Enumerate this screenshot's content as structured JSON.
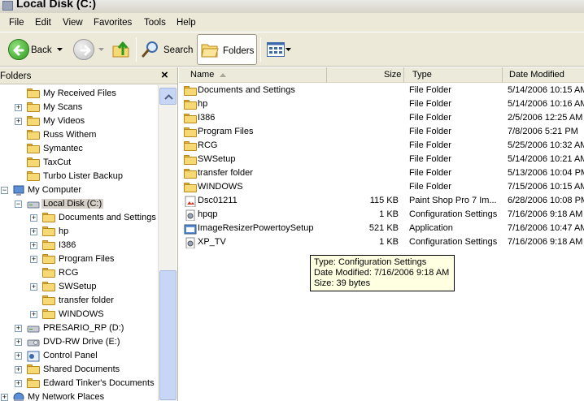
{
  "window": {
    "title": "Local Disk (C:)"
  },
  "menu": [
    "File",
    "Edit",
    "View",
    "Favorites",
    "Tools",
    "Help"
  ],
  "toolbar": {
    "back": "Back",
    "search": "Search",
    "folders": "Folders"
  },
  "folders_pane": {
    "title": "Folders",
    "close": "×",
    "items": [
      {
        "label": "My Received Files",
        "exp": ""
      },
      {
        "label": "My Scans",
        "exp": "+"
      },
      {
        "label": "My Videos",
        "exp": "+"
      },
      {
        "label": "Russ Withem",
        "exp": ""
      },
      {
        "label": "Symantec",
        "exp": ""
      },
      {
        "label": "TaxCut",
        "exp": ""
      },
      {
        "label": "Turbo Lister Backup",
        "exp": ""
      },
      {
        "label": "My Computer",
        "exp": "−"
      },
      {
        "label": "Local Disk (C:)",
        "exp": "−"
      },
      {
        "label": "Documents and Settings",
        "exp": "+"
      },
      {
        "label": "hp",
        "exp": "+"
      },
      {
        "label": "I386",
        "exp": "+"
      },
      {
        "label": "Program Files",
        "exp": "+"
      },
      {
        "label": "RCG",
        "exp": ""
      },
      {
        "label": "SWSetup",
        "exp": "+"
      },
      {
        "label": "transfer folder",
        "exp": ""
      },
      {
        "label": "WINDOWS",
        "exp": "+"
      },
      {
        "label": "PRESARIO_RP (D:)",
        "exp": "+"
      },
      {
        "label": "DVD-RW Drive (E:)",
        "exp": "+"
      },
      {
        "label": "Control Panel",
        "exp": "+"
      },
      {
        "label": "Shared Documents",
        "exp": "+"
      },
      {
        "label": "Edward Tinker's Documents",
        "exp": "+"
      },
      {
        "label": "My Network Places",
        "exp": "+"
      }
    ]
  },
  "columns": {
    "name": "Name",
    "size": "Size",
    "type": "Type",
    "modified": "Date Modified"
  },
  "files": [
    {
      "name": "Documents and Settings",
      "size": "",
      "type": "File Folder",
      "modified": "5/14/2006 10:15 AM",
      "icon": "folder"
    },
    {
      "name": "hp",
      "size": "",
      "type": "File Folder",
      "modified": "5/14/2006 10:16 AM",
      "icon": "folder"
    },
    {
      "name": "I386",
      "size": "",
      "type": "File Folder",
      "modified": "2/5/2006 12:25 AM",
      "icon": "folder"
    },
    {
      "name": "Program Files",
      "size": "",
      "type": "File Folder",
      "modified": "7/8/2006 5:21 PM",
      "icon": "folder"
    },
    {
      "name": "RCG",
      "size": "",
      "type": "File Folder",
      "modified": "5/25/2006 10:32 AM",
      "icon": "folder"
    },
    {
      "name": "SWSetup",
      "size": "",
      "type": "File Folder",
      "modified": "5/14/2006 10:21 AM",
      "icon": "folder"
    },
    {
      "name": "transfer folder",
      "size": "",
      "type": "File Folder",
      "modified": "5/13/2006 10:04 PM",
      "icon": "folder"
    },
    {
      "name": "WINDOWS",
      "size": "",
      "type": "File Folder",
      "modified": "7/15/2006 10:15 AM",
      "icon": "folder"
    },
    {
      "name": "Dsc01211",
      "size": "115 KB",
      "type": "Paint Shop Pro 7 Im...",
      "modified": "6/28/2006 10:08 PM",
      "icon": "image"
    },
    {
      "name": "hpqp",
      "size": "1 KB",
      "type": "Configuration Settings",
      "modified": "7/16/2006 9:18 AM",
      "icon": "config"
    },
    {
      "name": "ImageResizerPowertoySetup",
      "size": "521 KB",
      "type": "Application",
      "modified": "7/16/2006 10:47 AM",
      "icon": "app"
    },
    {
      "name": "XP_TV",
      "size": "1 KB",
      "type": "Configuration Settings",
      "modified": "7/16/2006 9:18 AM",
      "icon": "config"
    }
  ],
  "tooltip": {
    "type": "Type: Configuration Settings",
    "modified": "Date Modified: 7/16/2006 9:18 AM",
    "size": "Size: 39 bytes"
  }
}
